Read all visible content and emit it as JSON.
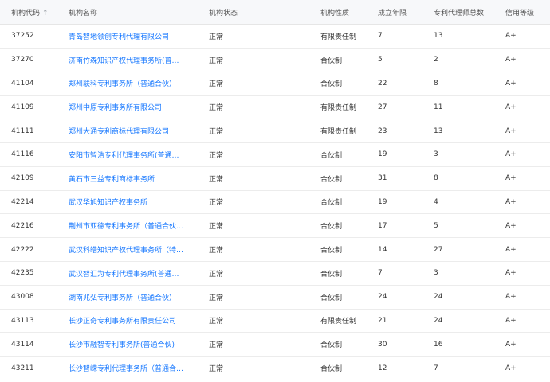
{
  "table": {
    "headers": {
      "code": "机构代码",
      "code_sort_icon": "arrow-up-icon",
      "name": "机构名称",
      "status": "机构状态",
      "nature": "机构性质",
      "years": "成立年限",
      "count": "专利代理师总数",
      "credit": "信用等级"
    },
    "colors": {
      "link": "#1677ff",
      "header_bg": "#f7f8fa",
      "border": "#ececec"
    },
    "rows": [
      {
        "code": "37252",
        "name": "青岛智地领创专利代理有限公司",
        "status": "正常",
        "nature": "有限责任制",
        "years": "7",
        "count": "13",
        "credit": "A+"
      },
      {
        "code": "37270",
        "name": "济南竹森知识产权代理事务所(普…",
        "status": "正常",
        "nature": "合伙制",
        "years": "5",
        "count": "2",
        "credit": "A+"
      },
      {
        "code": "41104",
        "name": "郑州联科专利事务所（普通合伙）",
        "status": "正常",
        "nature": "合伙制",
        "years": "22",
        "count": "8",
        "credit": "A+"
      },
      {
        "code": "41109",
        "name": "郑州中原专利事务所有限公司",
        "status": "正常",
        "nature": "有限责任制",
        "years": "27",
        "count": "11",
        "credit": "A+"
      },
      {
        "code": "41111",
        "name": "郑州大通专利商标代理有限公司",
        "status": "正常",
        "nature": "有限责任制",
        "years": "23",
        "count": "13",
        "credit": "A+"
      },
      {
        "code": "41116",
        "name": "安阳市智浩专利代理事务所(普通…",
        "status": "正常",
        "nature": "合伙制",
        "years": "19",
        "count": "3",
        "credit": "A+"
      },
      {
        "code": "42109",
        "name": "黄石市三益专利商标事务所",
        "status": "正常",
        "nature": "合伙制",
        "years": "31",
        "count": "8",
        "credit": "A+"
      },
      {
        "code": "42214",
        "name": "武汉华旭知识产权事务所",
        "status": "正常",
        "nature": "合伙制",
        "years": "19",
        "count": "4",
        "credit": "A+"
      },
      {
        "code": "42216",
        "name": "荆州市亚德专利事务所（普通合伙…",
        "status": "正常",
        "nature": "合伙制",
        "years": "17",
        "count": "5",
        "credit": "A+"
      },
      {
        "code": "42222",
        "name": "武汉科皓知识产权代理事务所（特…",
        "status": "正常",
        "nature": "合伙制",
        "years": "14",
        "count": "27",
        "credit": "A+"
      },
      {
        "code": "42235",
        "name": "武汉智汇为专利代理事务所(普通…",
        "status": "正常",
        "nature": "合伙制",
        "years": "7",
        "count": "3",
        "credit": "A+"
      },
      {
        "code": "43008",
        "name": "湖南兆弘专利事务所（普通合伙）",
        "status": "正常",
        "nature": "合伙制",
        "years": "24",
        "count": "24",
        "credit": "A+"
      },
      {
        "code": "43113",
        "name": "长沙正奇专利事务所有限责任公司",
        "status": "正常",
        "nature": "有限责任制",
        "years": "21",
        "count": "24",
        "credit": "A+"
      },
      {
        "code": "43114",
        "name": "长沙市融智专利事务所(普通合伙)",
        "status": "正常",
        "nature": "合伙制",
        "years": "30",
        "count": "16",
        "credit": "A+"
      },
      {
        "code": "43211",
        "name": "长沙智嵘专利代理事务所（普通合…",
        "status": "正常",
        "nature": "合伙制",
        "years": "12",
        "count": "7",
        "credit": "A+"
      }
    ]
  }
}
